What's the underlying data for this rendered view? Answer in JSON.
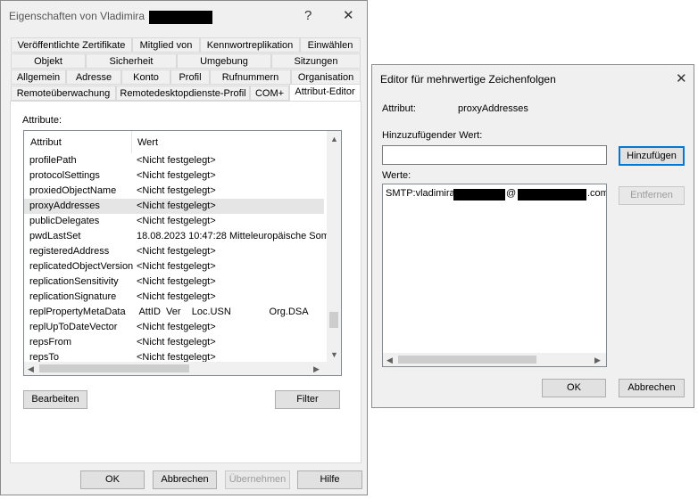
{
  "props": {
    "title": "Eigenschaften von Vladimira",
    "help_glyph": "?",
    "close_glyph": "✕",
    "tabs_row1": [
      "Veröffentlichte Zertifikate",
      "Mitglied von",
      "Kennwortreplikation",
      "Einwählen"
    ],
    "tabs_row2": [
      "Objekt",
      "Sicherheit",
      "Umgebung",
      "Sitzungen"
    ],
    "tabs_row3": [
      "Allgemein",
      "Adresse",
      "Konto",
      "Profil",
      "Rufnummern",
      "Organisation"
    ],
    "tabs_row4": [
      "Remoteüberwachung",
      "Remotedesktopdienste-Profil",
      "COM+",
      "Attribut-Editor"
    ],
    "attributes_label": "Attribute:",
    "col_attr": "Attribut",
    "col_value": "Wert",
    "rows": [
      {
        "name": "profilePath",
        "value": "<Nicht festgelegt>"
      },
      {
        "name": "protocolSettings",
        "value": "<Nicht festgelegt>"
      },
      {
        "name": "proxiedObjectName",
        "value": "<Nicht festgelegt>"
      },
      {
        "name": "proxyAddresses",
        "value": "<Nicht festgelegt>"
      },
      {
        "name": "publicDelegates",
        "value": "<Nicht festgelegt>"
      },
      {
        "name": "pwdLastSet",
        "value": "18.08.2023 10:47:28 Mitteleuropäische Som"
      },
      {
        "name": "registeredAddress",
        "value": "<Nicht festgelegt>"
      },
      {
        "name": "replicatedObjectVersion",
        "value": "<Nicht festgelegt>"
      },
      {
        "name": "replicationSensitivity",
        "value": "<Nicht festgelegt>"
      },
      {
        "name": "replicationSignature",
        "value": "<Nicht festgelegt>"
      },
      {
        "name": "replPropertyMetaData",
        "value": " AttID  Ver    Loc.USN              Org.DSA"
      },
      {
        "name": "replUpToDateVector",
        "value": "<Nicht festgelegt>"
      },
      {
        "name": "repsFrom",
        "value": "<Nicht festgelegt>"
      },
      {
        "name": "repsTo",
        "value": "<Nicht festgelegt>"
      }
    ],
    "edit_btn": "Bearbeiten",
    "filter_btn": "Filter",
    "ok_btn": "OK",
    "cancel_btn": "Abbrechen",
    "apply_btn": "Übernehmen",
    "help_btn": "Hilfe"
  },
  "editor": {
    "title": "Editor für mehrwertige Zeichenfolgen",
    "close_glyph": "✕",
    "attr_label": "Attribut:",
    "attr_value": "proxyAddresses",
    "add_label": "Hinzuzufügender Wert:",
    "add_value": "",
    "add_btn": "Hinzufügen",
    "values_label": "Werte:",
    "value_prefix": "SMTP:vladimira",
    "value_at": "@",
    "value_suffix": ".com",
    "remove_btn": "Entfernen",
    "ok_btn": "OK",
    "cancel_btn": "Abbrechen"
  }
}
